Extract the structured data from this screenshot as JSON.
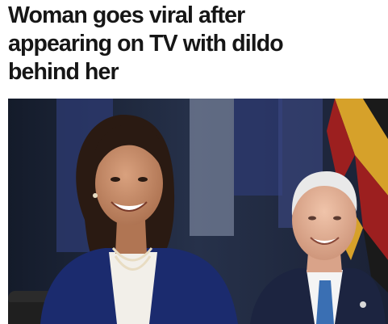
{
  "article": {
    "headline_lines": [
      "Woman goes viral after",
      "appearing on TV with dildo",
      "behind her"
    ]
  },
  "photo": {
    "left_figure": "woman-smiling",
    "right_figure": "man-smiling",
    "colors": {
      "background_dark": "#1d2638",
      "flag_blue": "#2d3b73",
      "flag_red": "#9c1f1f",
      "flag_gold": "#d6a12a",
      "jacket": "#1b2b6e",
      "tie": "#3a6fb3"
    }
  }
}
